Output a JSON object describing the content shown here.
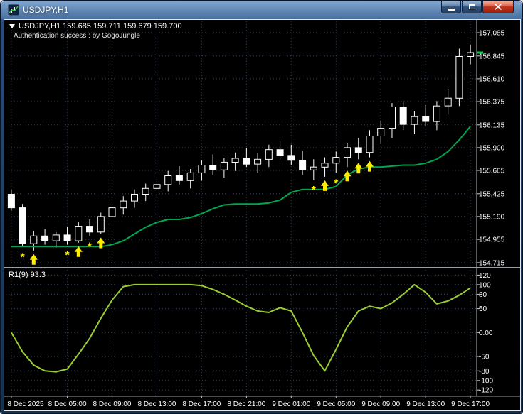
{
  "window": {
    "title": "USDJPY,H1"
  },
  "overlays": {
    "info_line": "USDJPY,H1 159.685 159.711 159.679 159.700",
    "auth_line": "Authentication success : by GogoJungle",
    "indicator_label": "R1(9) 93.3"
  },
  "colors": {
    "background": "#000000",
    "grid": "#3a4250",
    "candle": "#ffffff",
    "ma_line": "#00a550",
    "indicator_line": "#9acd32",
    "signal": "#ffee00",
    "axis_text": "#ffffff",
    "price_marker": "#00cc44",
    "titlebar": "#2a4d7c",
    "close_button": "#c0341c"
  },
  "chart_data": [
    {
      "type": "candlestick",
      "symbol": "USDJPY",
      "timeframe": "H1",
      "ohlc_label": {
        "open": 159.685,
        "high": 159.711,
        "low": 159.679,
        "close": 159.7
      },
      "ylim": [
        154.67,
        157.202
      ],
      "y_axis_values": [
        157.085,
        156.845,
        156.61,
        156.375,
        156.135,
        155.9,
        155.665,
        155.425,
        155.19,
        154.955,
        154.715
      ],
      "x_labels": [
        "8 Dec 2025",
        "8 Dec 05:00",
        "8 Dec 09:00",
        "8 Dec 13:00",
        "8 Dec 17:00",
        "8 Dec 21:00",
        "9 Dec 01:00",
        "9 Dec 05:00",
        "9 Dec 09:00",
        "9 Dec 13:00",
        "9 Dec 17:00"
      ],
      "x_label_indices": [
        0,
        5,
        9,
        13,
        17,
        21,
        25,
        29,
        33,
        37,
        41
      ],
      "grid": true,
      "legend_position": "none",
      "candles": [
        [
          155.42,
          155.47,
          155.25,
          155.28
        ],
        [
          155.28,
          155.32,
          154.88,
          154.91
        ],
        [
          154.91,
          155.04,
          154.84,
          154.99
        ],
        [
          154.99,
          155.06,
          154.9,
          154.94
        ],
        [
          154.94,
          155.03,
          154.87,
          155.0
        ],
        [
          155.0,
          155.08,
          154.9,
          154.94
        ],
        [
          154.94,
          155.13,
          154.92,
          155.09
        ],
        [
          155.09,
          155.16,
          154.99,
          155.03
        ],
        [
          155.03,
          155.23,
          155.01,
          155.19
        ],
        [
          155.19,
          155.32,
          155.13,
          155.28
        ],
        [
          155.28,
          155.4,
          155.21,
          155.35
        ],
        [
          155.35,
          155.47,
          155.28,
          155.42
        ],
        [
          155.42,
          155.53,
          155.35,
          155.48
        ],
        [
          155.48,
          155.58,
          155.4,
          155.52
        ],
        [
          155.52,
          155.66,
          155.45,
          155.61
        ],
        [
          155.61,
          155.71,
          155.52,
          155.56
        ],
        [
          155.56,
          155.68,
          155.48,
          155.64
        ],
        [
          155.64,
          155.77,
          155.56,
          155.72
        ],
        [
          155.72,
          155.83,
          155.62,
          155.67
        ],
        [
          155.67,
          155.79,
          155.59,
          155.75
        ],
        [
          155.75,
          155.85,
          155.66,
          155.79
        ],
        [
          155.79,
          155.9,
          155.7,
          155.73
        ],
        [
          155.73,
          155.84,
          155.64,
          155.78
        ],
        [
          155.78,
          155.93,
          155.7,
          155.88
        ],
        [
          155.88,
          155.96,
          155.78,
          155.82
        ],
        [
          155.82,
          155.93,
          155.72,
          155.77
        ],
        [
          155.77,
          155.87,
          155.62,
          155.67
        ],
        [
          155.67,
          155.78,
          155.57,
          155.7
        ],
        [
          155.7,
          155.8,
          155.6,
          155.74
        ],
        [
          155.74,
          155.86,
          155.64,
          155.8
        ],
        [
          155.8,
          155.95,
          155.7,
          155.9
        ],
        [
          155.9,
          156.0,
          155.78,
          155.85
        ],
        [
          155.85,
          156.08,
          155.8,
          156.02
        ],
        [
          156.02,
          156.18,
          155.94,
          156.1
        ],
        [
          156.1,
          156.36,
          156.0,
          156.32
        ],
        [
          156.32,
          156.38,
          156.08,
          156.14
        ],
        [
          156.14,
          156.28,
          156.04,
          156.22
        ],
        [
          156.22,
          156.34,
          156.12,
          156.17
        ],
        [
          156.17,
          156.38,
          156.08,
          156.33
        ],
        [
          156.33,
          156.5,
          156.24,
          156.41
        ],
        [
          156.41,
          156.92,
          156.33,
          156.84
        ],
        [
          156.84,
          156.96,
          156.76,
          156.88
        ]
      ],
      "ma_line": [
        154.88,
        154.88,
        154.88,
        154.88,
        154.88,
        154.88,
        154.88,
        154.88,
        154.88,
        154.9,
        154.94,
        155.01,
        155.08,
        155.13,
        155.16,
        155.16,
        155.18,
        155.22,
        155.27,
        155.31,
        155.32,
        155.32,
        155.32,
        155.33,
        155.36,
        155.44,
        155.47,
        155.47,
        155.47,
        155.5,
        155.62,
        155.68,
        155.7,
        155.7,
        155.71,
        155.72,
        155.72,
        155.74,
        155.78,
        155.86,
        155.98,
        156.12
      ],
      "signal_arrows": [
        2,
        6,
        8,
        28,
        30,
        31,
        32
      ],
      "signal_stars": [
        1,
        5,
        7,
        27,
        29
      ],
      "last_price": 156.88
    },
    {
      "type": "line",
      "name": "R1(9)",
      "current_value": 93.3,
      "ylim": [
        -133,
        131
      ],
      "levels": [
        120,
        100,
        80,
        50,
        0,
        -50,
        -80,
        -100,
        -120
      ],
      "level_labels": [
        "120",
        "100",
        "80",
        "50",
        "0.00",
        "-50",
        "-80",
        "-100",
        "-120"
      ],
      "values": [
        0,
        -40,
        -68,
        -80,
        -82,
        -76,
        -45,
        -12,
        30,
        68,
        96,
        100,
        100,
        100,
        100,
        100,
        100,
        98,
        90,
        80,
        68,
        55,
        45,
        42,
        52,
        45,
        0,
        -48,
        -80,
        -35,
        12,
        45,
        55,
        50,
        62,
        80,
        100,
        84,
        60,
        66,
        78,
        93.3
      ]
    }
  ]
}
